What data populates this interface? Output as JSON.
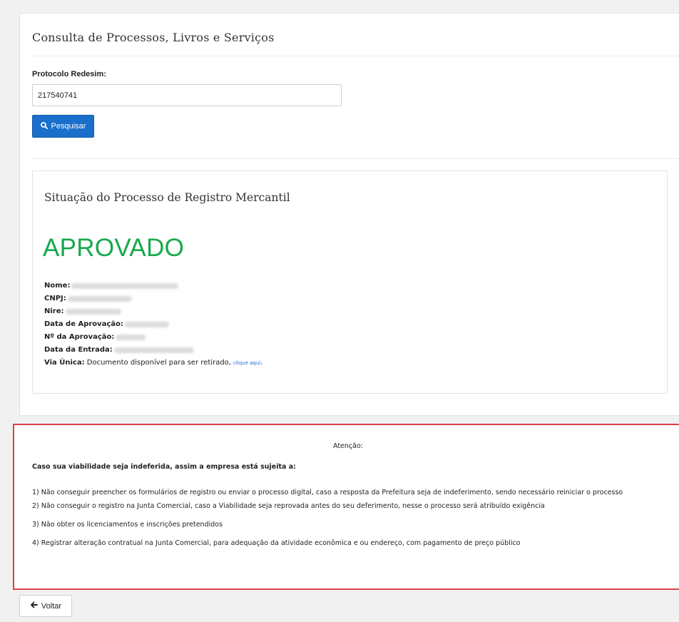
{
  "page": {
    "title": "Consulta de Processos, Livros e Serviços"
  },
  "search": {
    "label": "Protocolo Redesim:",
    "value": "217540741",
    "button_label": "Pesquisar",
    "button_icon": "search-icon",
    "button_color": "#1a6fcc"
  },
  "result": {
    "title": "Situação do Processo de Registro Mercantil",
    "status": "APROVADO",
    "status_color": "#19a84c",
    "fields": [
      {
        "label": "Nome:"
      },
      {
        "label": "CNPJ:"
      },
      {
        "label": "Nire:"
      },
      {
        "label": "Data de Aprovação:"
      },
      {
        "label": "Nº da Aprovação:"
      },
      {
        "label": "Data da Entrada:"
      }
    ],
    "via_unica": {
      "label": "Via Única:",
      "text": "Documento disponível para ser retirado,",
      "link": "clique aqui",
      "suffix": "."
    }
  },
  "attention": {
    "title": "Atenção:",
    "heading": "Caso sua viabilidade seja indeferida, assim a empresa está sujeita a:",
    "border_color": "#d8424a",
    "items": [
      "1) Não conseguir preencher os formulários de registro ou enviar o processo digital, caso a resposta da Prefeitura seja de indeferimento, sendo necessário reiniciar o processo",
      "2) Não conseguir o registro na Junta Comercial, caso a Viabilidade seja reprovada antes do seu deferimento, nesse o processo será atribuído exigência",
      "3) Não obter os licenciamentos e inscrições pretendidos",
      "4) Registrar alteração contratual na Junta Comercial, para adequação da atividade econômica e ou endereço, com pagamento de preço público"
    ]
  },
  "footer": {
    "back_label": "Voltar",
    "back_icon": "arrow-left-icon"
  }
}
